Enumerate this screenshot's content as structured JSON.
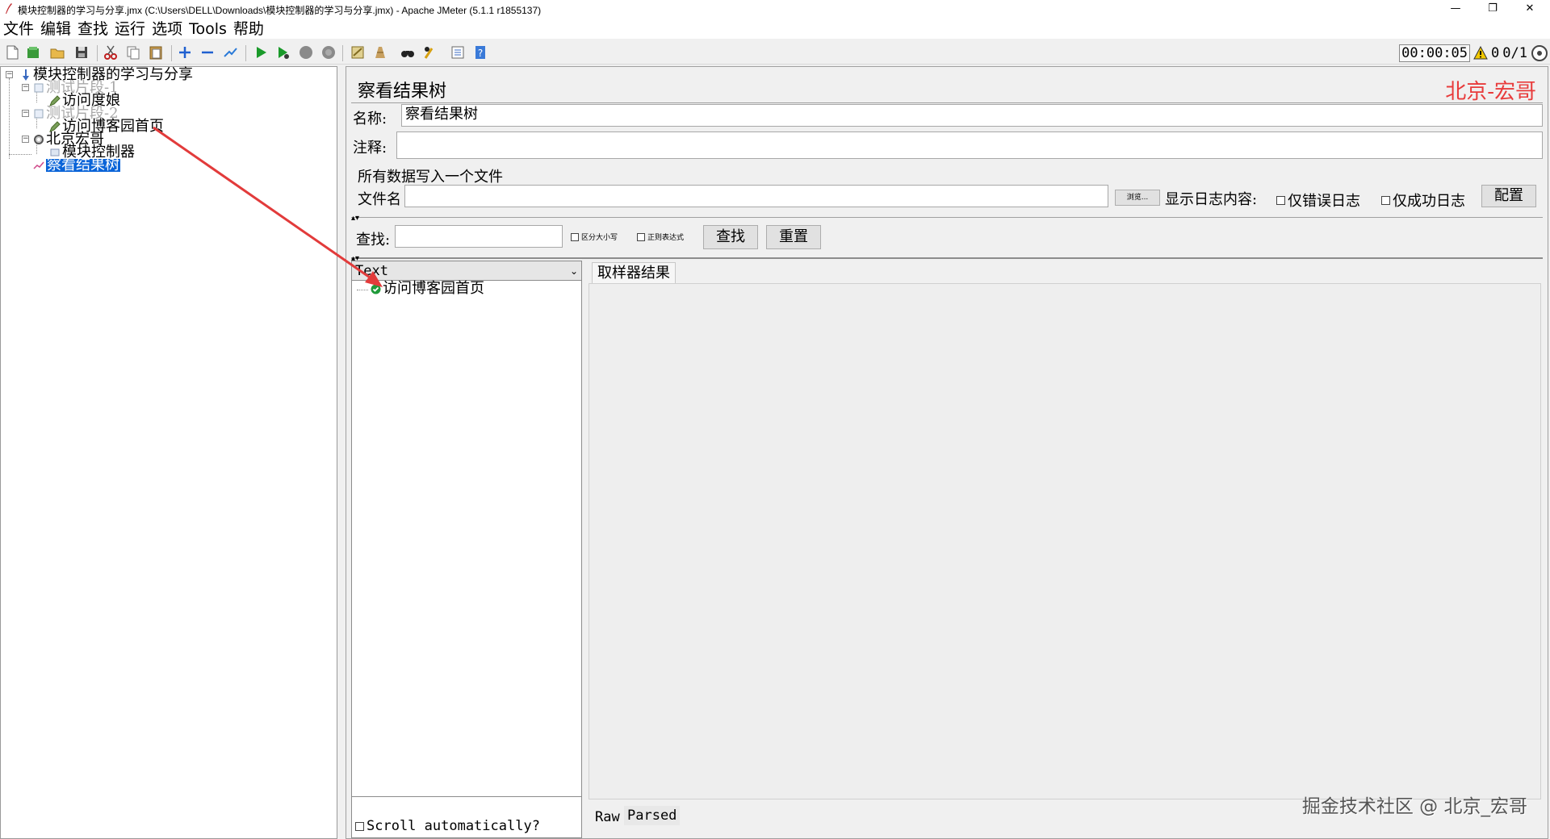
{
  "window": {
    "title": "模块控制器的学习与分享.jmx (C:\\Users\\DELL\\Downloads\\模块控制器的学习与分享.jmx) - Apache JMeter (5.1.1 r1855137)",
    "minimize": "—",
    "maximize": "❐",
    "close": "✕"
  },
  "menu": [
    "文件",
    "编辑",
    "查找",
    "运行",
    "选项",
    "Tools",
    "帮助"
  ],
  "toolbar_status": {
    "timer": "00:00:05",
    "warning_count": "0",
    "threads": "0/1"
  },
  "tree": {
    "root": "模块控制器的学习与分享",
    "items": [
      {
        "label": "测试片段-1"
      },
      {
        "label": "访问度娘"
      },
      {
        "label": "测试片段-2"
      },
      {
        "label": "访问博客园首页"
      },
      {
        "label": "北京宏哥"
      },
      {
        "label": "模块控制器"
      },
      {
        "label": "察看结果树"
      }
    ]
  },
  "panel": {
    "title": "察看结果树",
    "brand_watermark": "北京-宏哥",
    "name_label": "名称:",
    "name_value": "察看结果树",
    "comment_label": "注释:",
    "comment_value": "",
    "write_section_title": "所有数据写入一个文件",
    "file_label": "文件名",
    "file_value": "",
    "browse_button": "浏览...",
    "log_display_label": "显示日志内容:",
    "errors_only_label": "仅错误日志",
    "success_only_label": "仅成功日志",
    "configure_button": "配置",
    "search_label": "查找:",
    "search_value": "",
    "case_sensitive_label": "区分大小写",
    "regex_label": "正则表达式",
    "find_button": "查找",
    "reset_button": "重置",
    "renderer_value": "Text",
    "results": [
      {
        "label": "访问博客园首页",
        "status": "success"
      }
    ],
    "sampler_tab": "取样器结果",
    "scroll_auto_label": "Scroll automatically?",
    "raw_tab": "Raw",
    "parsed_tab": "Parsed"
  },
  "footer_watermark": "掘金技术社区 @ 北京_宏哥",
  "colors": {
    "selection": "#0a64d8",
    "annotation_arrow": "#e23b3b",
    "brand_text": "#e83b3b",
    "success_icon": "#1f9a3a"
  }
}
